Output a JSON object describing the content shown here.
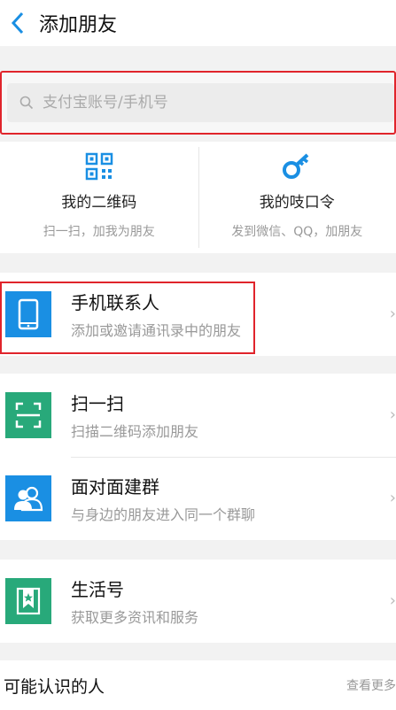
{
  "header": {
    "title": "添加朋友"
  },
  "search": {
    "placeholder": "支付宝账号/手机号"
  },
  "codes": [
    {
      "title": "我的二维码",
      "subtitle": "扫一扫，加我为朋友",
      "icon": "qr-code-icon"
    },
    {
      "title": "我的吱口令",
      "subtitle": "发到微信、QQ，加朋友",
      "icon": "key-icon"
    }
  ],
  "rows": [
    {
      "title": "手机联系人",
      "subtitle": "添加或邀请通讯录中的朋友",
      "icon": "phone-icon",
      "color": "#1a8fe3"
    },
    {
      "title": "扫一扫",
      "subtitle": "扫描二维码添加朋友",
      "icon": "scan-icon",
      "color": "#28a97a"
    },
    {
      "title": "面对面建群",
      "subtitle": "与身边的朋友进入同一个群聊",
      "icon": "people-icon",
      "color": "#1a8fe3"
    },
    {
      "title": "生活号",
      "subtitle": "获取更多资讯和服务",
      "icon": "star-bookmark-icon",
      "color": "#28a97a"
    }
  ],
  "footer": {
    "title": "可能认识的人",
    "more": "查看更多"
  },
  "colors": {
    "accent": "#1a8fe3",
    "green": "#28a97a",
    "highlight": "#e0242b"
  }
}
